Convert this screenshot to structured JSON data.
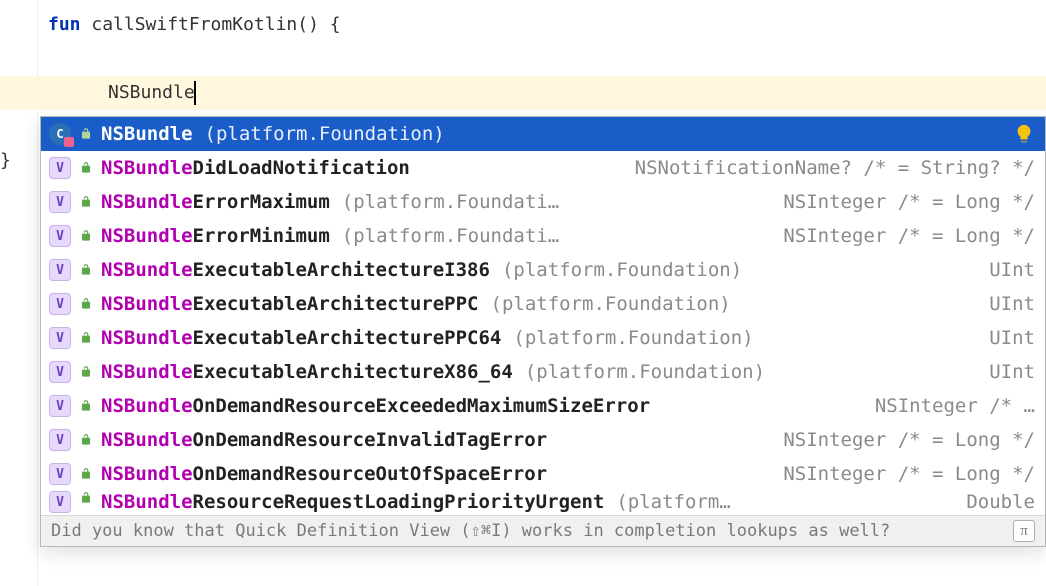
{
  "code": {
    "line1_kw": "fun",
    "line1_sig": " callSwiftFromKotlin() {",
    "line3_typed": "NSBundle",
    "line5_brace": "}"
  },
  "popup": {
    "tip": "Did you know that Quick Definition View (⇧⌘I) works in completion lookups as well?",
    "pi_label": "π",
    "items": [
      {
        "kind": "class",
        "match": "NSBundle",
        "rest": "",
        "hint": "(platform.Foundation)",
        "type": ""
      },
      {
        "kind": "var",
        "match": "NSBundle",
        "rest": "DidLoadNotification",
        "hint": "",
        "type": "NSNotificationName? /* = String? */"
      },
      {
        "kind": "var",
        "match": "NSBundle",
        "rest": "ErrorMaximum",
        "hint": "(platform.Foundati…",
        "type": "NSInteger /* = Long */"
      },
      {
        "kind": "var",
        "match": "NSBundle",
        "rest": "ErrorMinimum",
        "hint": "(platform.Foundati…",
        "type": "NSInteger /* = Long */"
      },
      {
        "kind": "var",
        "match": "NSBundle",
        "rest": "ExecutableArchitectureI386",
        "hint": "(platform.Foundation)",
        "type": "UInt"
      },
      {
        "kind": "var",
        "match": "NSBundle",
        "rest": "ExecutableArchitecturePPC",
        "hint": "(platform.Foundation)",
        "type": "UInt"
      },
      {
        "kind": "var",
        "match": "NSBundle",
        "rest": "ExecutableArchitecturePPC64",
        "hint": "(platform.Foundation)",
        "type": "UInt"
      },
      {
        "kind": "var",
        "match": "NSBundle",
        "rest": "ExecutableArchitectureX86_64",
        "hint": "(platform.Foundation)",
        "type": "UInt"
      },
      {
        "kind": "var",
        "match": "NSBundle",
        "rest": "OnDemandResourceExceededMaximumSizeError",
        "hint": "",
        "type": "NSInteger /* …"
      },
      {
        "kind": "var",
        "match": "NSBundle",
        "rest": "OnDemandResourceInvalidTagError",
        "hint": "",
        "type": "NSInteger /* = Long */"
      },
      {
        "kind": "var",
        "match": "NSBundle",
        "rest": "OnDemandResourceOutOfSpaceError",
        "hint": "",
        "type": "NSInteger /* = Long */"
      },
      {
        "kind": "var",
        "match": "NSBundle",
        "rest": "ResourceRequestLoadingPriorityUrgent",
        "hint": "(platform…",
        "type": "Double"
      }
    ]
  },
  "icons": {
    "var_letter": "V",
    "class_letter": "C"
  }
}
